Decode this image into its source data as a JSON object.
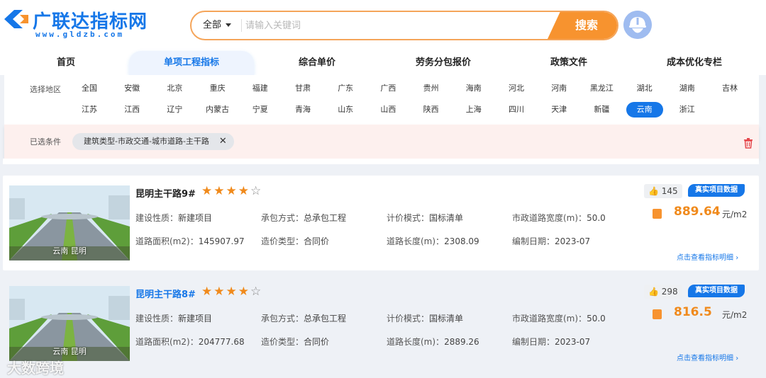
{
  "brand": {
    "name": "广联达指标网",
    "url": "www.gldzb.com",
    "primary_color": "#1677e8",
    "accent_color": "#f7932f"
  },
  "search": {
    "scope": "全部",
    "placeholder": "请输入关键词",
    "button": "搜索"
  },
  "nav": {
    "tabs": [
      "首页",
      "单项工程指标",
      "综合单价",
      "劳务分包报价",
      "政策文件",
      "成本优化专栏"
    ],
    "active": "单项工程指标"
  },
  "filter": {
    "region_label": "选择地区",
    "regions_row1": [
      "全国",
      "安徽",
      "北京",
      "重庆",
      "福建",
      "甘肃",
      "广东",
      "广西",
      "贵州",
      "海南",
      "河北",
      "河南",
      "黑龙江",
      "湖北",
      "湖南",
      "吉林"
    ],
    "regions_row2": [
      "江苏",
      "江西",
      "辽宁",
      "内蒙古",
      "宁夏",
      "青海",
      "山东",
      "山西",
      "陕西",
      "上海",
      "四川",
      "天津",
      "新疆",
      "云南",
      "浙江"
    ],
    "selected_region": "云南",
    "conditions_label": "已选条件",
    "condition_tag": "建筑类型-市政交通-城市道路-主干路",
    "close_icon": "✕",
    "trash_icon": "trash-icon"
  },
  "projects": [
    {
      "title": "昆明主干路9#",
      "rating": 4,
      "rating_max": 5,
      "location": "云南 昆明",
      "likes": "145",
      "badge": "真实项目数据",
      "build_nature_label": "建设性质：",
      "build_nature": "新建项目",
      "contract_label": "承包方式：",
      "contract": "总承包工程",
      "pricing_label": "计价模式：",
      "pricing": "国标清单",
      "width_label": "市政道路宽度(m)：",
      "width": "50.0",
      "area_label": "道路面积(m2)：",
      "area": "145907.97",
      "cost_type_label": "造价类型：",
      "cost_type": "合同价",
      "length_label": "道路长度(m)：",
      "length": "2308.09",
      "date_label": "编制日期：",
      "date": "2023-07",
      "price": "889.64",
      "unit": "元/m2",
      "detail_link": "点击查看指标明细"
    },
    {
      "title": "昆明主干路8#",
      "rating": 4,
      "rating_max": 5,
      "location": "云南 昆明",
      "likes": "298",
      "badge": "真实项目数据",
      "build_nature_label": "建设性质：",
      "build_nature": "新建项目",
      "contract_label": "承包方式：",
      "contract": "总承包工程",
      "pricing_label": "计价模式：",
      "pricing": "国标清单",
      "width_label": "市政道路宽度(m)：",
      "width": "50.0",
      "area_label": "道路面积(m2)：",
      "area": "204777.68",
      "cost_type_label": "造价类型：",
      "cost_type": "合同价",
      "length_label": "道路长度(m)：",
      "length": "2889.26",
      "date_label": "编制日期：",
      "date": "2023-07",
      "price": "816.5",
      "unit": "元/m2",
      "detail_link": "点击查看指标明细"
    }
  ],
  "watermark": "大数跨境"
}
